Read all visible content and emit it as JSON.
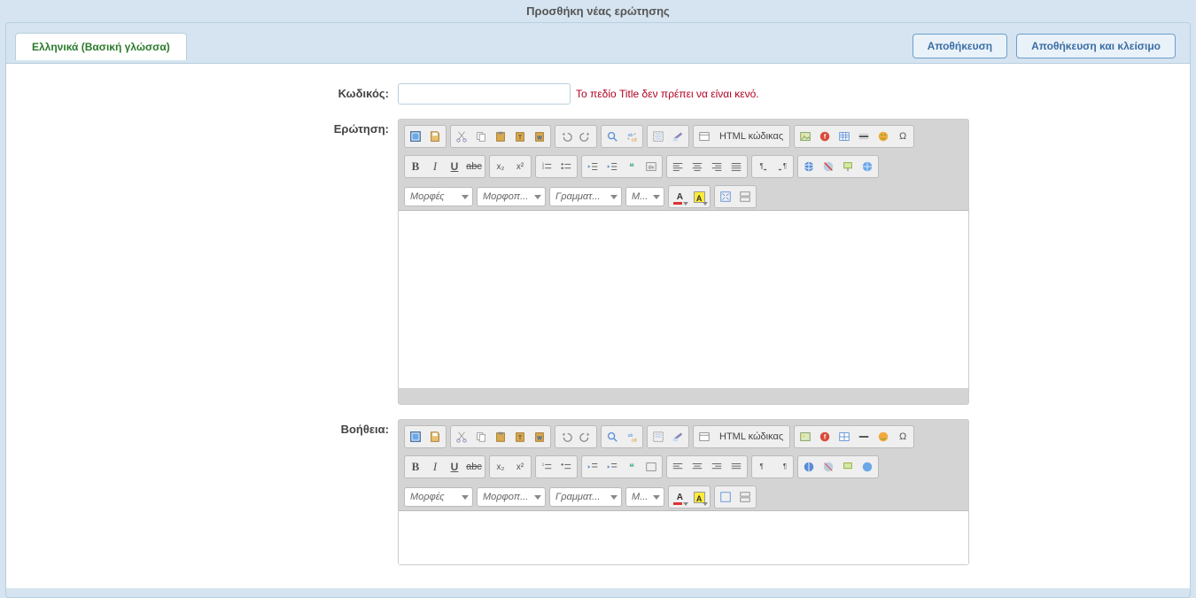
{
  "page_title": "Προσθήκη νέας ερώτησης",
  "tab_label": "Ελληνικά (Βασική γλώσσα)",
  "buttons": {
    "save": "Αποθήκευση",
    "save_close": "Αποθήκευση και κλείσιμο"
  },
  "fields": {
    "code_label": "Κωδικός:",
    "code_value": "",
    "code_error": "Το πεδίο Title δεν πρέπει να είναι κενό.",
    "question_label": "Ερώτηση:",
    "help_label": "Βοήθεια:"
  },
  "editor": {
    "html_label": "HTML κώδικας",
    "combos": {
      "styles": "Μορφές",
      "format": "Μορφοπ...",
      "font": "Γραμματ...",
      "size": "Μ..."
    },
    "glyphs": {
      "bold": "B",
      "italic": "I",
      "underline": "U",
      "strike": "abc",
      "sub": "x₂",
      "sup": "x²",
      "quote": "❝",
      "omega": "Ω"
    }
  }
}
